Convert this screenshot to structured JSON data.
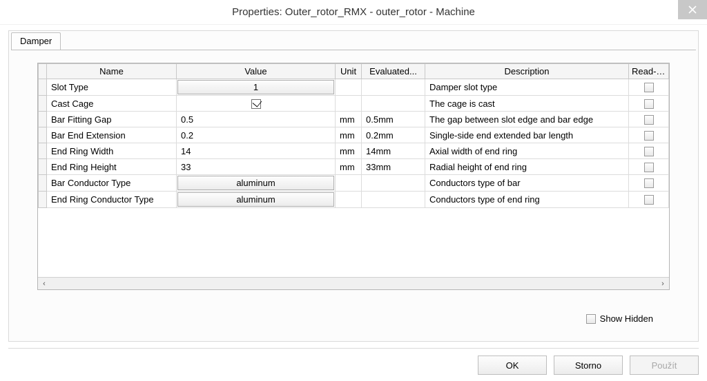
{
  "titlebar": {
    "title": "Properties: Outer_rotor_RMX - outer_rotor - Machine"
  },
  "tabs": [
    {
      "label": "Damper"
    }
  ],
  "table": {
    "headers": {
      "name": "Name",
      "value": "Value",
      "unit": "Unit",
      "evaluated": "Evaluated...",
      "description": "Description",
      "readonly": "Read-o..."
    },
    "rows": [
      {
        "name": "Slot Type",
        "value": "1",
        "value_kind": "button",
        "unit": "",
        "evaluated": "",
        "description": "Damper slot type",
        "readonly": false
      },
      {
        "name": "Cast Cage",
        "value": "",
        "value_kind": "checkbox",
        "checked": true,
        "unit": "",
        "evaluated": "",
        "description": "The cage is cast",
        "readonly": false
      },
      {
        "name": "Bar Fitting Gap",
        "value": "0.5",
        "value_kind": "text",
        "unit": "mm",
        "evaluated": "0.5mm",
        "description": "The gap between slot edge and bar edge",
        "readonly": false
      },
      {
        "name": "Bar End Extension",
        "value": "0.2",
        "value_kind": "text",
        "unit": "mm",
        "evaluated": "0.2mm",
        "description": "Single-side end extended bar length",
        "readonly": false
      },
      {
        "name": "End Ring Width",
        "value": "14",
        "value_kind": "text",
        "unit": "mm",
        "evaluated": "14mm",
        "description": "Axial width of end ring",
        "readonly": false
      },
      {
        "name": "End Ring Height",
        "value": "33",
        "value_kind": "text",
        "unit": "mm",
        "evaluated": "33mm",
        "description": "Radial height of end ring",
        "readonly": false
      },
      {
        "name": "Bar Conductor Type",
        "value": "aluminum",
        "value_kind": "button",
        "unit": "",
        "evaluated": "",
        "description": "Conductors type of bar",
        "readonly": false
      },
      {
        "name": "End Ring Conductor Type",
        "value": "aluminum",
        "value_kind": "button",
        "unit": "",
        "evaluated": "",
        "description": "Conductors type of end ring",
        "readonly": false
      }
    ]
  },
  "footer": {
    "show_hidden_label": "Show Hidden",
    "show_hidden_checked": false
  },
  "buttons": {
    "ok": "OK",
    "cancel": "Storno",
    "apply": "Použít"
  }
}
